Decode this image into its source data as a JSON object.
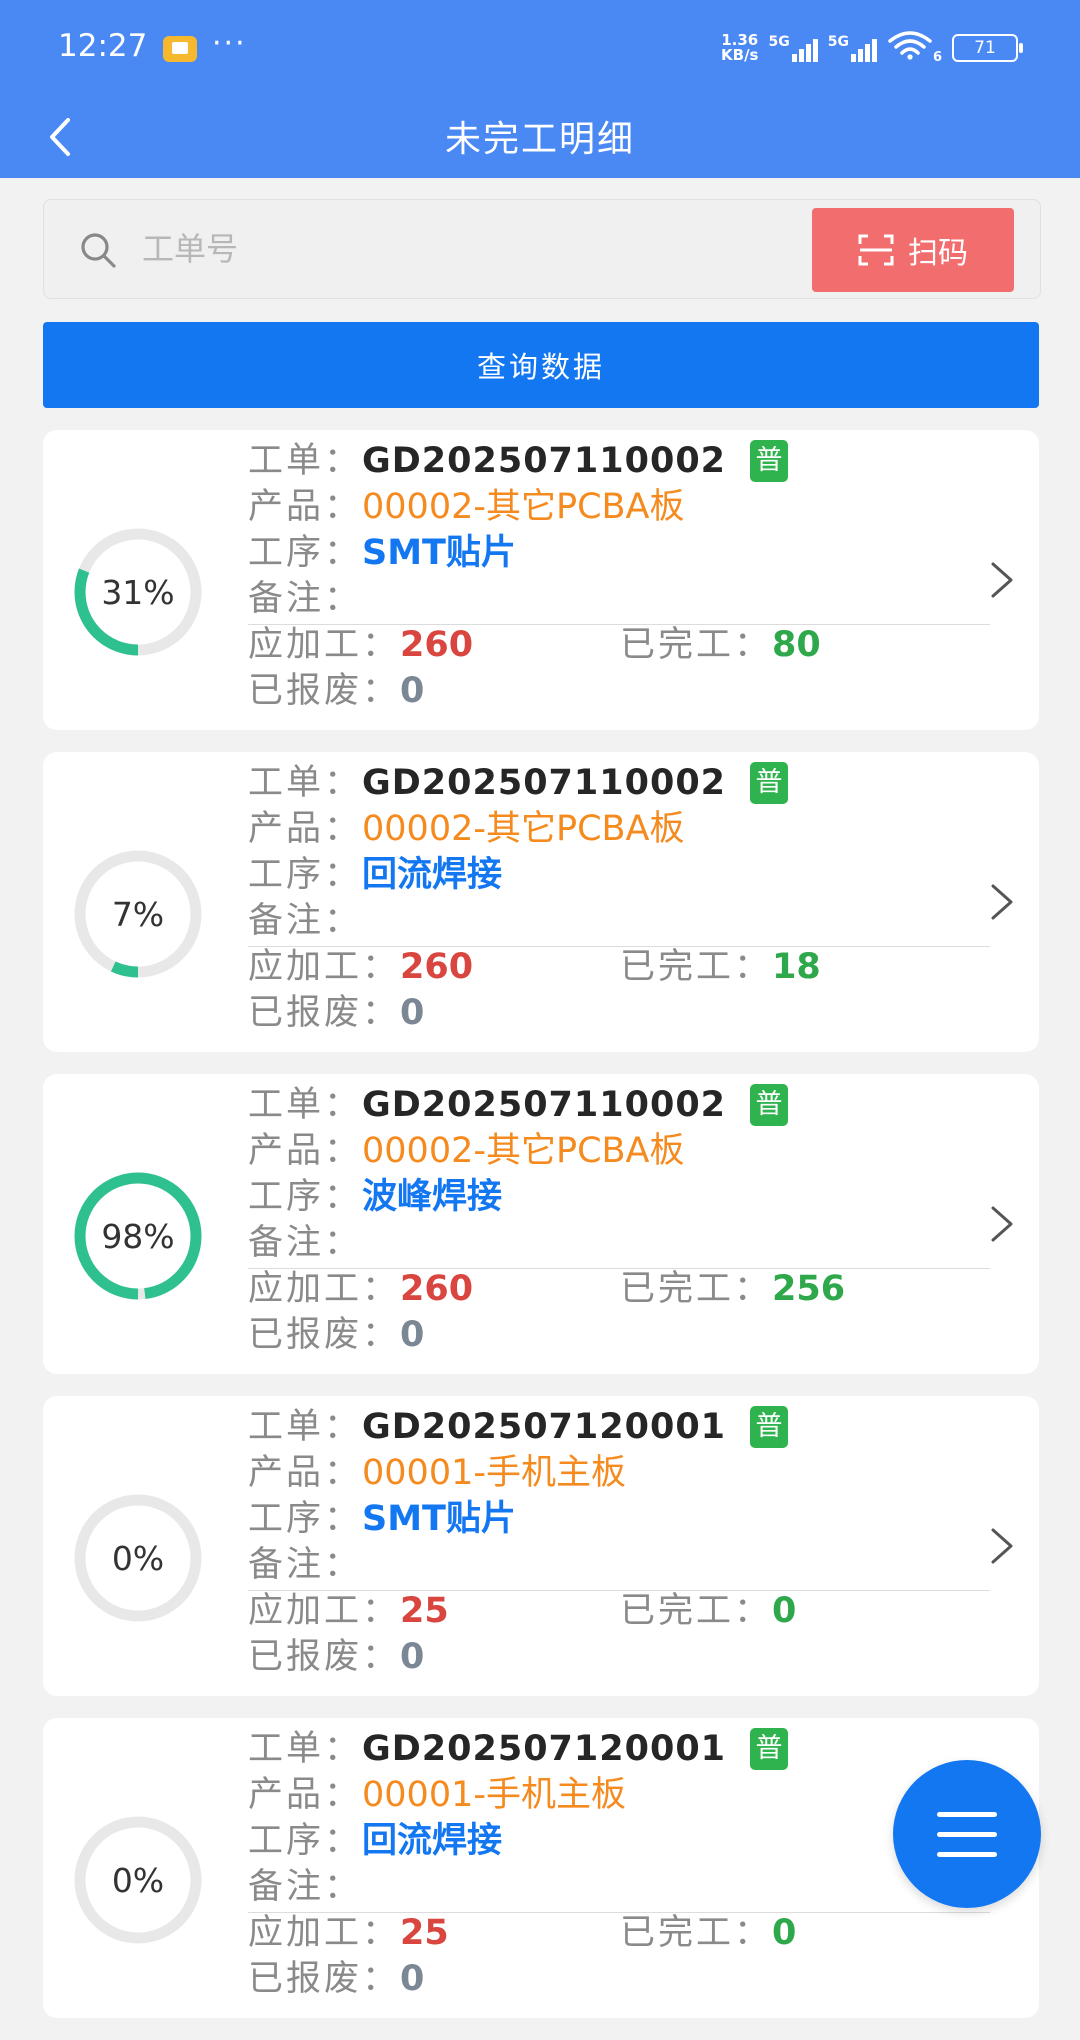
{
  "status_bar": {
    "time": "12:27",
    "more": "···",
    "speed_value": "1.36",
    "speed_unit": "KB/s",
    "sim1": "5G",
    "sim2": "5G",
    "wifi_index": "6",
    "battery": "71"
  },
  "header": {
    "title": "未完工明细",
    "background": "#4a89f3"
  },
  "search": {
    "placeholder": "工单号",
    "value": "",
    "scan_label": "扫码",
    "scan_color": "#f26d6d"
  },
  "query_button": {
    "label": "查询数据",
    "color": "#1377f2"
  },
  "field_labels": {
    "order": "工单：",
    "product": "产品：",
    "process": "工序：",
    "remark": "备注：",
    "planned": "应加工：",
    "completed": "已完工：",
    "scrapped": "已报废："
  },
  "orders": [
    {
      "percent_label": "31%",
      "progress": 0.31,
      "order_no": "GD202507110002",
      "tag": "普",
      "product": "00002-其它PCBA板",
      "process": "SMT贴片",
      "remark": "",
      "planned": "260",
      "completed": "80",
      "scrapped": "0"
    },
    {
      "percent_label": "7%",
      "progress": 0.07,
      "order_no": "GD202507110002",
      "tag": "普",
      "product": "00002-其它PCBA板",
      "process": "回流焊接",
      "remark": "",
      "planned": "260",
      "completed": "18",
      "scrapped": "0"
    },
    {
      "percent_label": "98%",
      "progress": 0.98,
      "order_no": "GD202507110002",
      "tag": "普",
      "product": "00002-其它PCBA板",
      "process": "波峰焊接",
      "remark": "",
      "planned": "260",
      "completed": "256",
      "scrapped": "0"
    },
    {
      "percent_label": "0%",
      "progress": 0,
      "order_no": "GD202507120001",
      "tag": "普",
      "product": "00001-手机主板",
      "process": "SMT贴片",
      "remark": "",
      "planned": "25",
      "completed": "0",
      "scrapped": "0"
    },
    {
      "percent_label": "0%",
      "progress": 0,
      "order_no": "GD202507120001",
      "tag": "普",
      "product": "00001-手机主板",
      "process": "回流焊接",
      "remark": "",
      "planned": "25",
      "completed": "0",
      "scrapped": "0"
    }
  ],
  "colors": {
    "progress_ring": "#2ec18f",
    "ring_track": "#e8e8e8",
    "tag": "#2fb34e"
  },
  "icons": {
    "back": "chevron-left-icon",
    "search": "search-icon",
    "scan": "scan-icon",
    "row_arrow": "chevron-right-icon",
    "fab": "menu-icon"
  }
}
